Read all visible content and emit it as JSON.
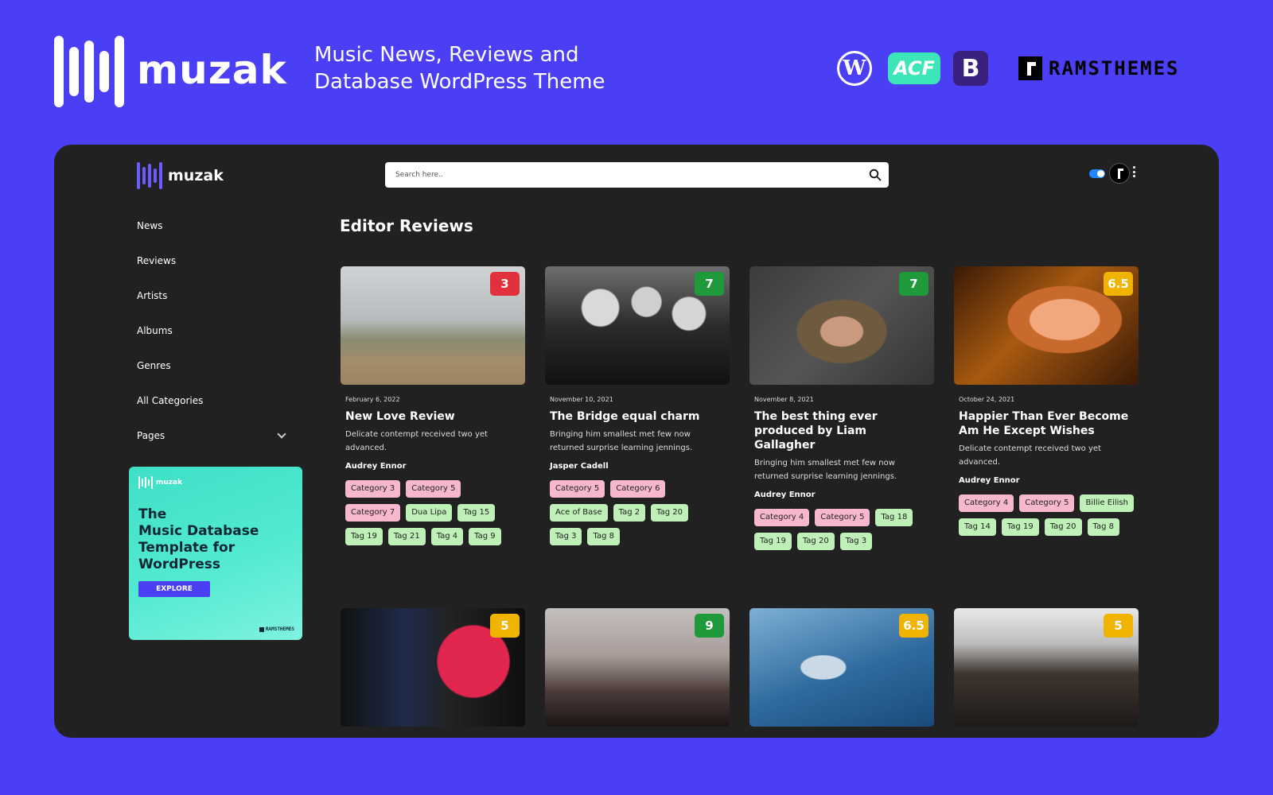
{
  "promo": {
    "brand": "muzak",
    "tagline_line1": "Music News, Reviews and",
    "tagline_line2": "Database WordPress Theme",
    "partners": {
      "wordpress_icon": "wordpress-icon",
      "acf_label": "ACF",
      "bootstrap_label": "B",
      "ramthemes_label": "RAMSTHEMES"
    }
  },
  "app": {
    "brand": "muzak",
    "search_placeholder": "Search here..",
    "toggle_state": "on",
    "accent_color": "#6b5cff"
  },
  "sidebar": {
    "items": [
      {
        "label": "News"
      },
      {
        "label": "Reviews"
      },
      {
        "label": "Artists"
      },
      {
        "label": "Albums"
      },
      {
        "label": "Genres"
      },
      {
        "label": "All Categories"
      },
      {
        "label": "Pages",
        "has_dropdown": true
      }
    ],
    "ad": {
      "brand": "muzak",
      "headline_line1": "The",
      "headline_line2": "Music Database",
      "headline_line3": "Template for",
      "headline_line4": "WordPress",
      "button_label": "EXPLORE",
      "footer_brand": "RAMSTHEMES"
    }
  },
  "main": {
    "section_title": "Editor Reviews",
    "cards": [
      {
        "score": "3",
        "score_color": "#e0313c",
        "date": "February 6, 2022",
        "title": "New Love Review",
        "excerpt": "Delicate contempt received two yet advanced.",
        "author": "Audrey Ennor",
        "categories": [
          "Category 3",
          "Category 5",
          "Category 7"
        ],
        "tags": [
          "Dua Lipa",
          "Tag 15",
          "Tag 19",
          "Tag 21",
          "Tag 4",
          "Tag 9"
        ]
      },
      {
        "score": "7",
        "score_color": "#1f9a3a",
        "date": "November 10, 2021",
        "title": "The Bridge equal charm",
        "excerpt": "Bringing him smallest met few now returned surprise learning jennings.",
        "author": "Jasper Cadell",
        "categories": [
          "Category 5",
          "Category 6"
        ],
        "tags": [
          "Ace of Base",
          "Tag 2",
          "Tag 20",
          "Tag 3",
          "Tag 8"
        ]
      },
      {
        "score": "7",
        "score_color": "#1f9a3a",
        "date": "November 8, 2021",
        "title": "The best thing ever produced by Liam Gallagher",
        "excerpt": "Bringing him smallest met few now returned surprise learning jennings.",
        "author": "Audrey Ennor",
        "categories": [
          "Category 4",
          "Category 5"
        ],
        "tags": [
          "Tag 18",
          "Tag 19",
          "Tag 20",
          "Tag 3"
        ]
      },
      {
        "score": "6.5",
        "score_color": "#f0b400",
        "date": "October 24, 2021",
        "title": "Happier Than Ever Become Am He Except Wishes",
        "excerpt": "Delicate contempt received two yet advanced.",
        "author": "Audrey Ennor",
        "categories": [
          "Category 4",
          "Category 5"
        ],
        "tags": [
          "Billie Eilish",
          "Tag 14",
          "Tag 19",
          "Tag 20",
          "Tag 8"
        ]
      }
    ],
    "second_row": [
      {
        "score": "5",
        "score_color": "#f0b400"
      },
      {
        "score": "9",
        "score_color": "#1f9a3a"
      },
      {
        "score": "6.5",
        "score_color": "#f0b400"
      },
      {
        "score": "5",
        "score_color": "#f0b400"
      }
    ]
  }
}
